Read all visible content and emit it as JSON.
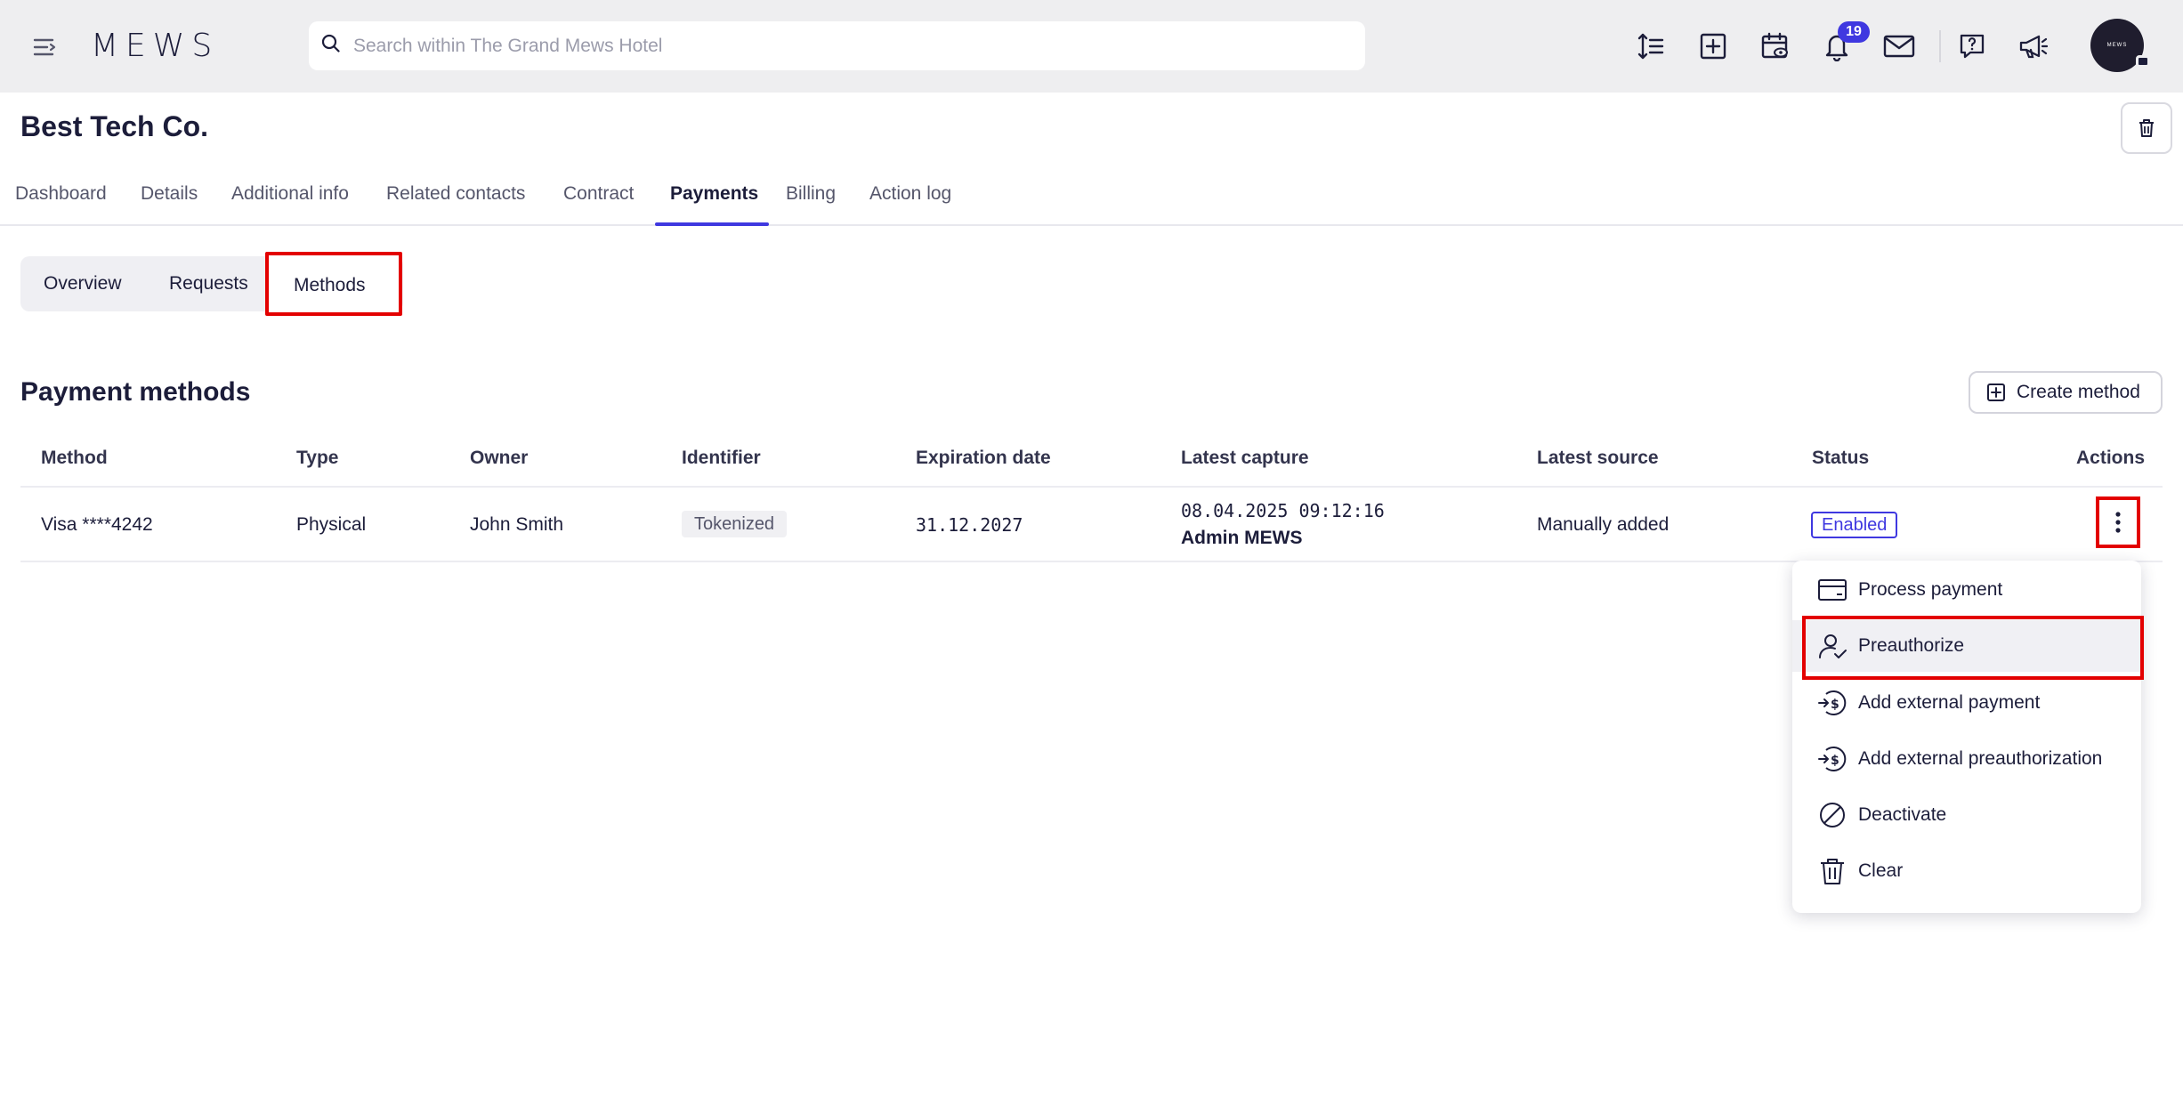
{
  "topbar": {
    "logo": "MEWS",
    "search_placeholder": "Search within The Grand Mews Hotel",
    "notifications_count": "19",
    "avatar_text": "MEWS"
  },
  "page": {
    "title": "Best Tech Co."
  },
  "tabs": [
    {
      "label": "Dashboard",
      "active": false
    },
    {
      "label": "Details",
      "active": false
    },
    {
      "label": "Additional info",
      "active": false
    },
    {
      "label": "Related contacts",
      "active": false
    },
    {
      "label": "Contract",
      "active": false
    },
    {
      "label": "Payments",
      "active": true
    },
    {
      "label": "Billing",
      "active": false
    },
    {
      "label": "Action log",
      "active": false
    }
  ],
  "subtabs": [
    {
      "label": "Overview",
      "active": false
    },
    {
      "label": "Requests",
      "active": false
    },
    {
      "label": "Methods",
      "active": true
    }
  ],
  "section": {
    "title": "Payment methods",
    "create_label": "Create method"
  },
  "table": {
    "headers": [
      "Method",
      "Type",
      "Owner",
      "Identifier",
      "Expiration date",
      "Latest capture",
      "Latest source",
      "Status",
      "Actions"
    ],
    "rows": [
      {
        "method": "Visa ****4242",
        "type": "Physical",
        "owner": "John Smith",
        "identifier": "Tokenized",
        "expiration": "31.12.2027",
        "capture_time": "08.04.2025 09:12:16",
        "capture_user": "Admin MEWS",
        "source": "Manually added",
        "status": "Enabled"
      }
    ]
  },
  "actions_menu": [
    {
      "label": "Process payment",
      "icon": "card-icon"
    },
    {
      "label": "Preauthorize",
      "icon": "user-check-icon"
    },
    {
      "label": "Add external payment",
      "icon": "external-dollar-icon"
    },
    {
      "label": "Add external preauthorization",
      "icon": "external-dollar-icon"
    },
    {
      "label": "Deactivate",
      "icon": "prohibit-icon"
    },
    {
      "label": "Clear",
      "icon": "trash-icon"
    }
  ],
  "colors": {
    "accent": "#3f38e0",
    "highlight_outline": "#e30000",
    "topbar_bg": "#eeeef0"
  }
}
